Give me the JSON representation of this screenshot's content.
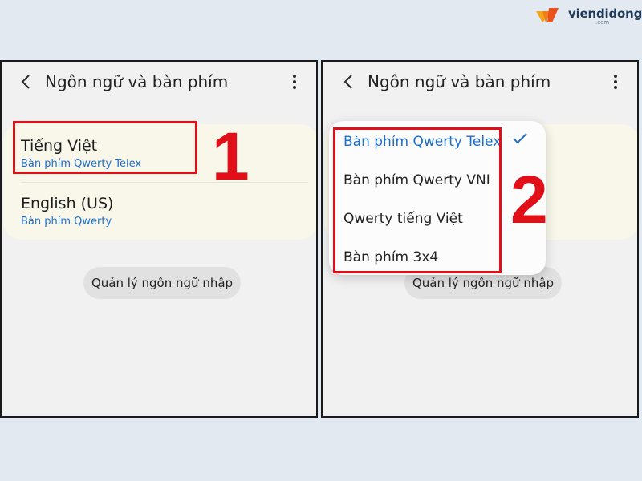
{
  "brand": {
    "name": "viendidong",
    "sub": ".com"
  },
  "colors": {
    "accent": "#1e6fc6",
    "annotation": "#e10f17",
    "card_bg": "#f8f7ea",
    "panel_bg": "#f1f1f1"
  },
  "left_screen": {
    "header": {
      "title": "Ngôn ngữ và bàn phím",
      "back_icon": "chevron-left-icon",
      "menu_icon": "more-vertical-icon"
    },
    "languages": [
      {
        "name": "Tiếng Việt",
        "keyboard": "Bàn phím Qwerty Telex"
      },
      {
        "name": "English (US)",
        "keyboard": "Bàn phím Qwerty"
      }
    ],
    "manage_button": "Quản lý ngôn ngữ nhập",
    "step_label": "1"
  },
  "right_screen": {
    "header": {
      "title": "Ngôn ngữ và bàn phím",
      "back_icon": "chevron-left-icon",
      "menu_icon": "more-vertical-icon"
    },
    "keyboard_options": [
      {
        "label": "Bàn phím Qwerty Telex",
        "selected": true
      },
      {
        "label": "Bàn phím Qwerty VNI",
        "selected": false
      },
      {
        "label": "Qwerty tiếng Việt",
        "selected": false
      },
      {
        "label": "Bàn phím 3x4",
        "selected": false
      }
    ],
    "manage_button": "Quản lý ngôn ngữ nhập",
    "step_label": "2"
  }
}
